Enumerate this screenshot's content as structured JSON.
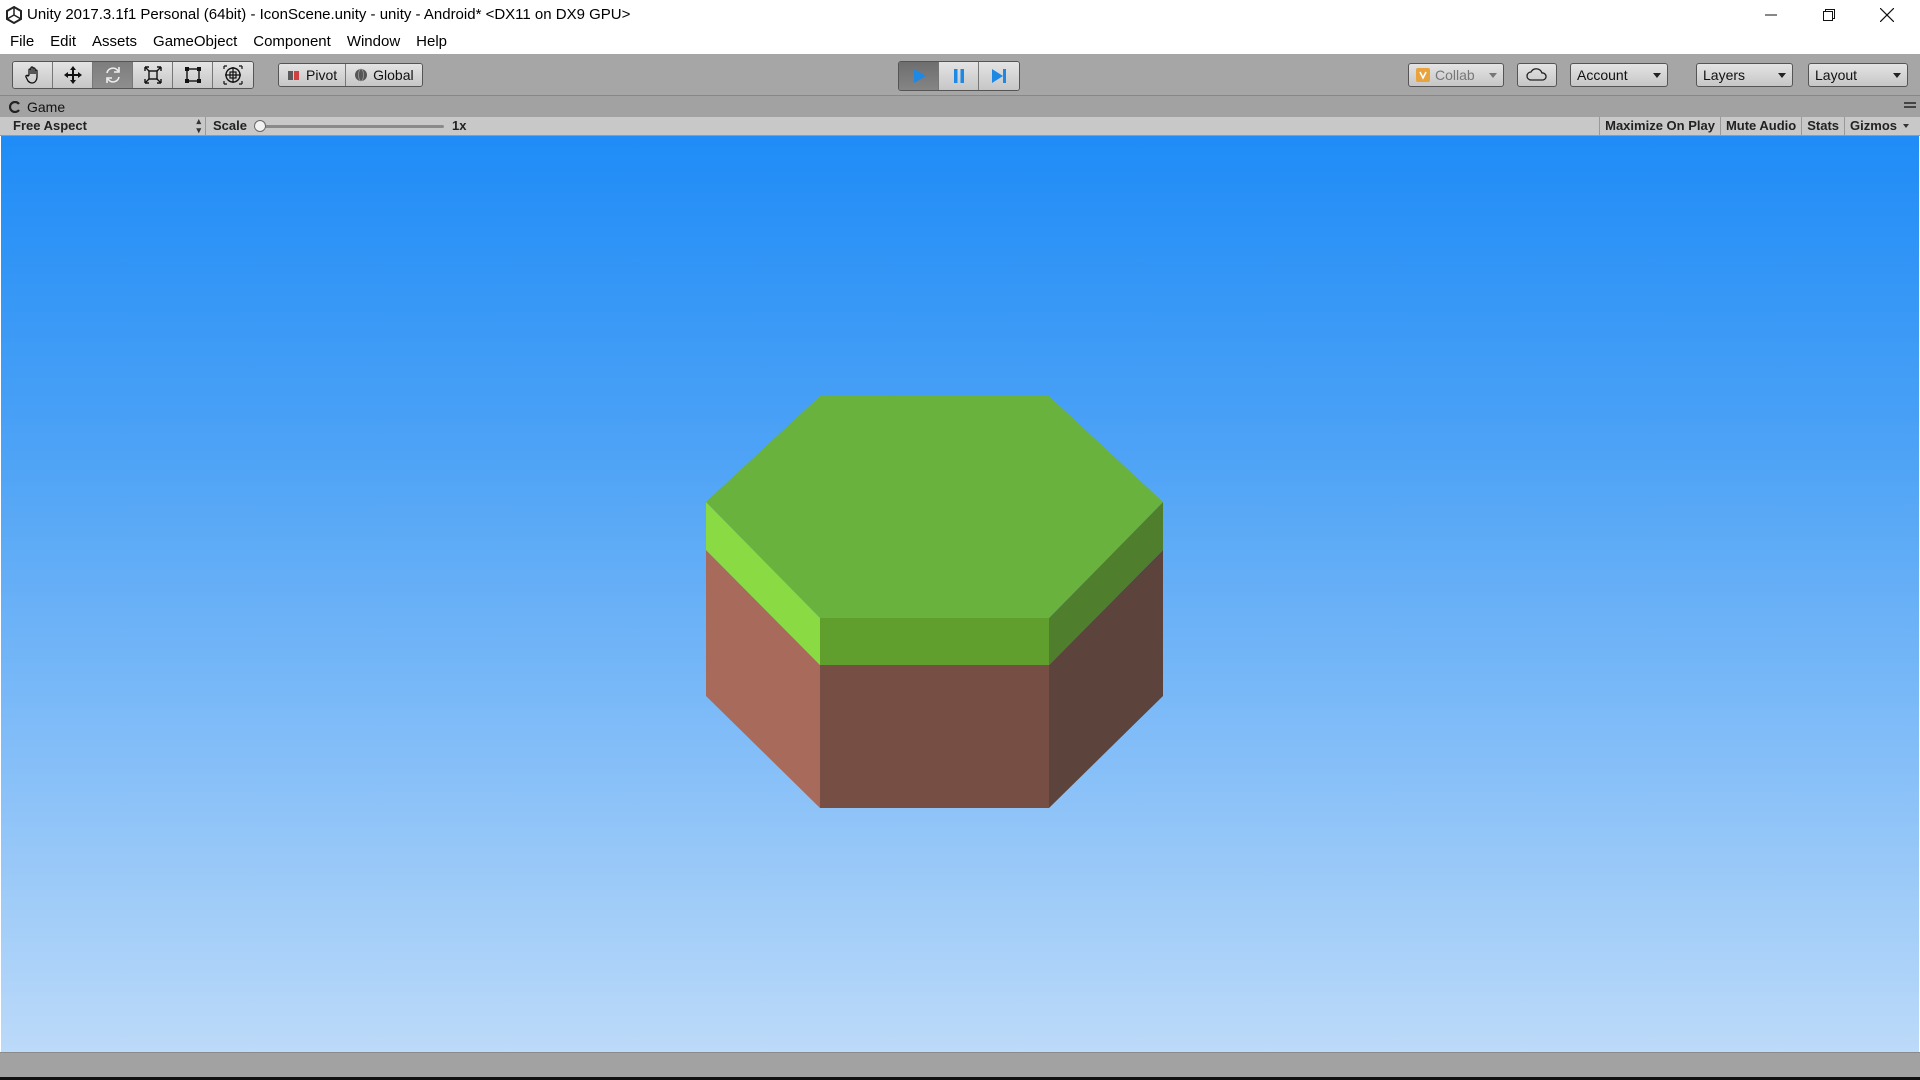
{
  "window": {
    "title": "Unity 2017.3.1f1 Personal (64bit) - IconScene.unity - unity - Android* <DX11 on DX9 GPU>"
  },
  "menu": {
    "items": [
      "File",
      "Edit",
      "Assets",
      "GameObject",
      "Component",
      "Window",
      "Help"
    ]
  },
  "toolbar": {
    "tools": [
      "hand-tool",
      "move-tool",
      "rotate-tool",
      "scale-tool",
      "rect-tool",
      "transform-tool"
    ],
    "active_tool": "rotate-tool",
    "pivot_label": "Pivot",
    "global_label": "Global",
    "play_active": true,
    "collab_label": "Collab",
    "account_label": "Account",
    "layers_label": "Layers",
    "layout_label": "Layout"
  },
  "game_view": {
    "tab_label": "Game",
    "aspect_label": "Free Aspect",
    "scale_label": "Scale",
    "scale_value": "1x",
    "buttons": [
      "Maximize On Play",
      "Mute Audio",
      "Stats",
      "Gizmos"
    ]
  },
  "scene": {
    "sky_top": "#1f8cf7",
    "sky_bottom": "#bcdaf9",
    "grass_top": "#6ab23e",
    "grass_side_left": "#8adb43",
    "grass_side_front": "#609f2e",
    "grass_side_right": "#4f7f2d",
    "dirt_left": "#a86b5b",
    "dirt_front": "#774e43",
    "dirt_right": "#5c433c"
  },
  "colors": {
    "play_icon": "#1e88e5"
  }
}
